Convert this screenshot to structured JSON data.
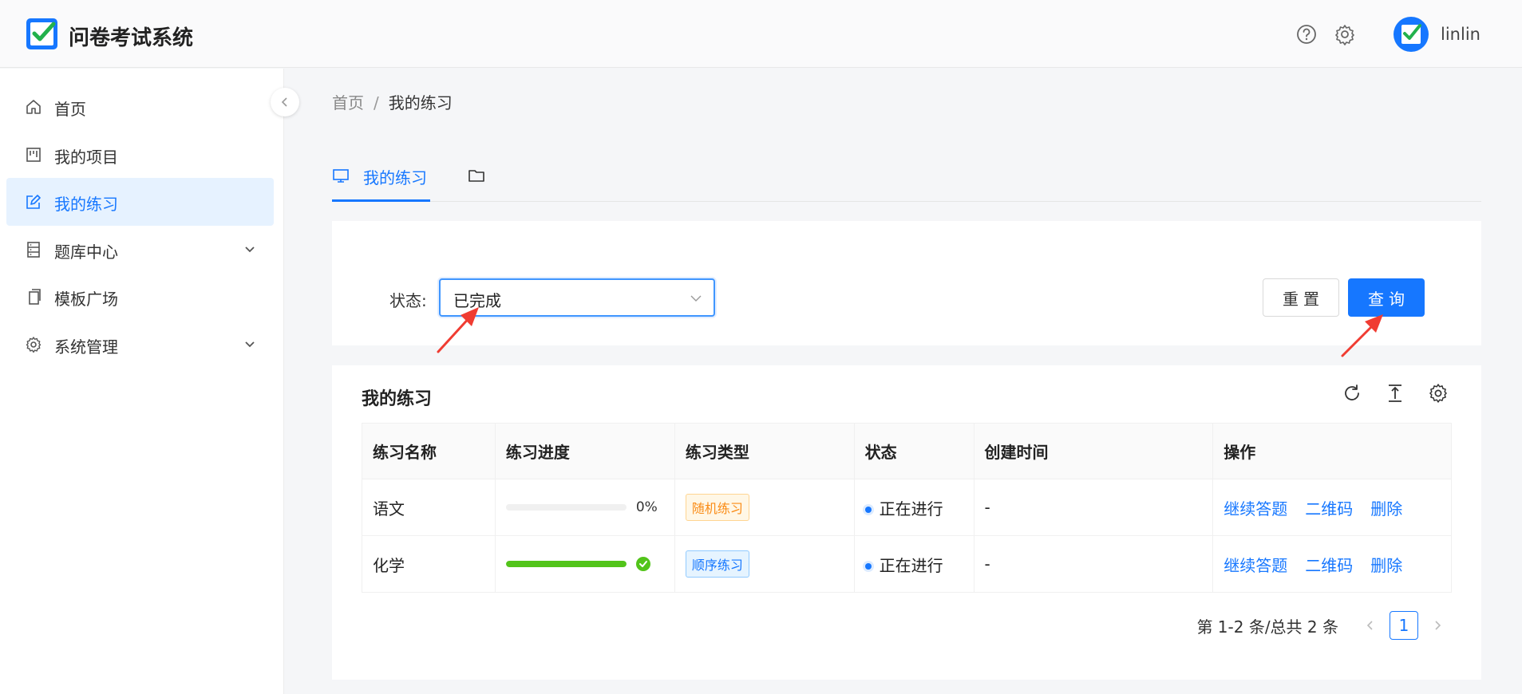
{
  "header": {
    "app_title": "问卷考试系统",
    "username": "linlin"
  },
  "sidebar": {
    "items": [
      {
        "label": "首页",
        "icon": "home-icon"
      },
      {
        "label": "我的项目",
        "icon": "project-icon"
      },
      {
        "label": "我的练习",
        "icon": "edit-icon",
        "active": true
      },
      {
        "label": "题库中心",
        "icon": "database-icon",
        "expandable": true
      },
      {
        "label": "模板广场",
        "icon": "copy-icon"
      },
      {
        "label": "系统管理",
        "icon": "gear-icon",
        "expandable": true
      }
    ]
  },
  "breadcrumb": {
    "home": "首页",
    "separator": "/",
    "current": "我的练习"
  },
  "tabs": {
    "active_label": "我的练习"
  },
  "filter": {
    "status_label": "状态:",
    "status_value": "已完成",
    "reset_label": "重置",
    "query_label": "查询"
  },
  "table": {
    "title": "我的练习",
    "columns": [
      "练习名称",
      "练习进度",
      "练习类型",
      "状态",
      "创建时间",
      "操作"
    ],
    "rows": [
      {
        "name": "语文",
        "progress": 0,
        "progress_text": "0%",
        "type": "随机练习",
        "status": "正在进行",
        "created": "-",
        "actions": [
          "继续答题",
          "二维码",
          "删除"
        ]
      },
      {
        "name": "化学",
        "progress": 100,
        "progress_text": "",
        "type": "顺序练习",
        "status": "正在进行",
        "created": "-",
        "actions": [
          "继续答题",
          "二维码",
          "删除"
        ]
      }
    ]
  },
  "pagination": {
    "summary": "第 1-2 条/总共 2 条",
    "current_page": "1"
  },
  "colors": {
    "primary": "#1677ff",
    "success": "#52c41a",
    "annotation": "#f03c32"
  }
}
